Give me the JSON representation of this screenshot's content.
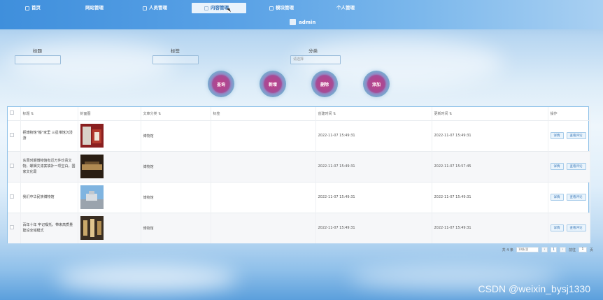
{
  "nav": {
    "items": [
      {
        "label": "首页",
        "icon": "home-icon"
      },
      {
        "label": "网站管理",
        "icon": "site-icon"
      },
      {
        "label": "人员管理",
        "icon": "users-icon"
      },
      {
        "label": "内容管理",
        "icon": "content-icon",
        "active": true
      },
      {
        "label": "模块管理",
        "icon": "module-icon"
      },
      {
        "label": "个人管理",
        "icon": "profile-icon"
      }
    ],
    "username": "admin"
  },
  "filters": {
    "title_label": "标题",
    "title_value": "",
    "tag_label": "标签",
    "tag_value": "",
    "category_label": "分类",
    "category_placeholder": "请选择"
  },
  "actions": {
    "search": "查询",
    "add": "新增",
    "delete": "删除",
    "export": "添加"
  },
  "table": {
    "headers": [
      "标题",
      "封面图",
      "文章分类",
      "标签",
      "创建时间",
      "更新时间",
      "操作"
    ],
    "rows": [
      {
        "title": "把博物馆\"搬\"家里 三星堆馆沉浸游",
        "category": "博物馆",
        "tag": "",
        "created": "2022-11-07 15:49:31",
        "updated": "2022-11-07 15:49:31"
      },
      {
        "title": "东周时期博物馆有近万件珍贵文物，螺钿文漆案填补一项空白，国家文化局",
        "category": "博物馆",
        "tag": "",
        "created": "2022-11-07 15:49:31",
        "updated": "2022-11-07 15:57:45"
      },
      {
        "title": "我们中华民族博物馆",
        "category": "博物馆",
        "tag": "",
        "created": "2022-11-07 15:49:31",
        "updated": "2022-11-07 15:49:31"
      },
      {
        "title": "百年十年 牢记嘱托，带来高质量建设全域模式",
        "category": "博物馆",
        "tag": "",
        "created": "2022-11-07 15:49:31",
        "updated": "2022-11-07 15:49:31"
      }
    ],
    "op_detail": "详情",
    "op_comment": "查看评论"
  },
  "pager": {
    "total": "共 4 条",
    "page_size": "10条/页",
    "prev": "‹",
    "current": "1",
    "next": "›",
    "goto_label": "前往",
    "goto_value": "1",
    "page_suffix": "页"
  },
  "watermark": "CSDN @weixin_bysj1330",
  "colors": {
    "accent": "#3f8fdc",
    "circle_button": "#b5448e"
  }
}
